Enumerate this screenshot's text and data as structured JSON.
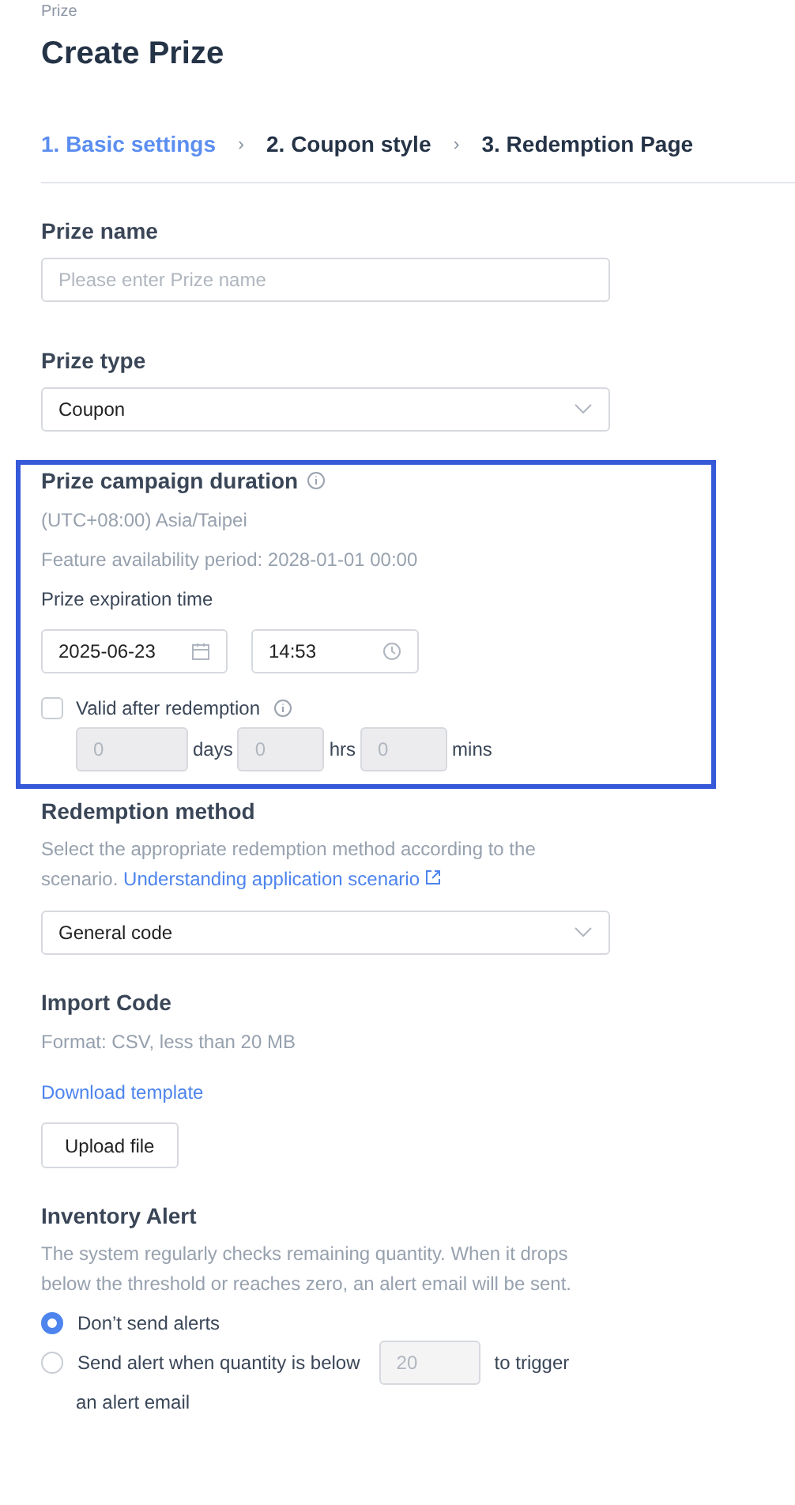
{
  "breadcrumb": "Prize",
  "title": "Create Prize",
  "steps": [
    {
      "label": "1. Basic settings",
      "selected": true
    },
    {
      "label": "2. Coupon style",
      "selected": false
    },
    {
      "label": "3. Redemption Page",
      "selected": false
    }
  ],
  "step_separator": "›",
  "prize_name": {
    "label": "Prize name",
    "placeholder": "Please enter Prize name"
  },
  "prize_type": {
    "label": "Prize type",
    "value": "Coupon"
  },
  "campaign_duration": {
    "highlighted": true,
    "label": "Prize campaign duration",
    "timezone": "(UTC+08:00) Asia/Taipei",
    "availability": "Feature availability period: 2028-01-01 00:00",
    "expiration_label": "Prize expiration time",
    "date": "2025-06-23",
    "time": "14:53",
    "valid_after": {
      "label": "Valid after redemption",
      "checked": false,
      "fields": [
        {
          "placeholder": "0",
          "unit": "days",
          "disabled": true
        },
        {
          "placeholder": "0",
          "unit": "hrs",
          "disabled": true
        },
        {
          "placeholder": "0",
          "unit": "mins",
          "disabled": true
        }
      ]
    }
  },
  "redemption_method": {
    "label": "Redemption method",
    "description": "Select the appropriate redemption method according to the scenario.",
    "link": "Understanding application scenario",
    "value": "General code"
  },
  "import_code": {
    "label": "Import Code",
    "format": "Format: CSV, less than 20 MB",
    "download_link": "Download template",
    "upload_button": "Upload file"
  },
  "inventory_alert": {
    "label": "Inventory Alert",
    "description": "The system regularly checks remaining quantity. When it drops below the threshold or reaches zero, an alert email will be sent.",
    "options": [
      {
        "kind": "plain",
        "label": "Don’t send alerts",
        "selected": true
      },
      {
        "kind": "threshold",
        "label_before": "Send alert when quantity is below",
        "placeholder": "20",
        "label_after": "to trigger",
        "label_wrap": "an alert email",
        "selected": false
      }
    ]
  }
}
